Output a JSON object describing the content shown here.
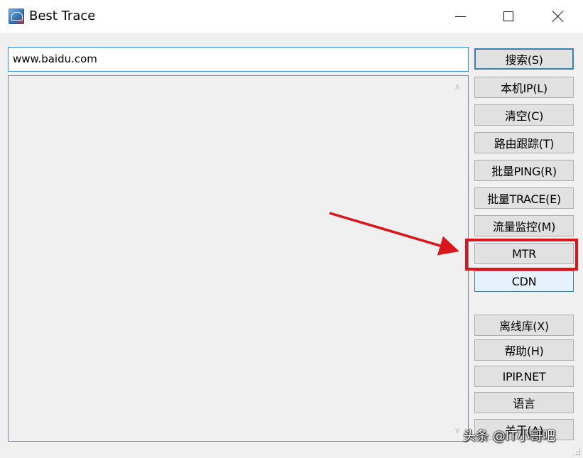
{
  "window": {
    "title": "Best Trace",
    "controls": {
      "minimize": "minimize",
      "maximize": "maximize",
      "close": "close"
    }
  },
  "address": {
    "value": "www.baidu.com"
  },
  "buttons": {
    "search": "搜索(S)",
    "local_ip": "本机IP(L)",
    "clear": "清空(C)",
    "route_trace": "路由跟踪(T)",
    "batch_ping": "批量PING(R)",
    "batch_trace": "批量TRACE(E)",
    "traffic_monitor": "流量监控(M)",
    "mtr": "MTR",
    "cdn": "CDN",
    "offline_db": "离线库(X)",
    "help": "帮助(H)",
    "ipip": "IPIP.NET",
    "language": "语言",
    "about": "关于(A)"
  },
  "annotation": {
    "color": "#d9161b",
    "target": "MTR"
  },
  "watermark": "头条 @IT小哥吧",
  "icons": {
    "app": "best-trace-app-icon",
    "scroll_up": "chevron-up-icon",
    "scroll_down": "chevron-down-icon"
  }
}
